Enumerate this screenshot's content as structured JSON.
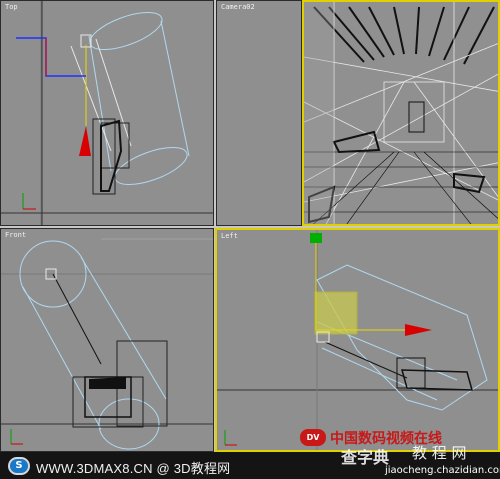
{
  "viewports": {
    "top": {
      "label": "Top"
    },
    "camera": {
      "label": "Camera02"
    },
    "front": {
      "label": "Front"
    },
    "left": {
      "label": "Left"
    }
  },
  "colors": {
    "viewport_bg": "#8f8f8f",
    "active_border": "#e0d000",
    "gizmo_red": "#e00000",
    "gizmo_green": "#00a000",
    "light_blue": "#b0d8f0"
  },
  "footer": {
    "site_text": "WWW.3DMAX8.CN @ 3D教程网",
    "brand_text": "中国数码视频在线",
    "brand_logo": "DV",
    "watermark_main": "查字典",
    "watermark_sub": "教 程 网",
    "watermark_url": "jiaocheng.chazidian.com"
  }
}
